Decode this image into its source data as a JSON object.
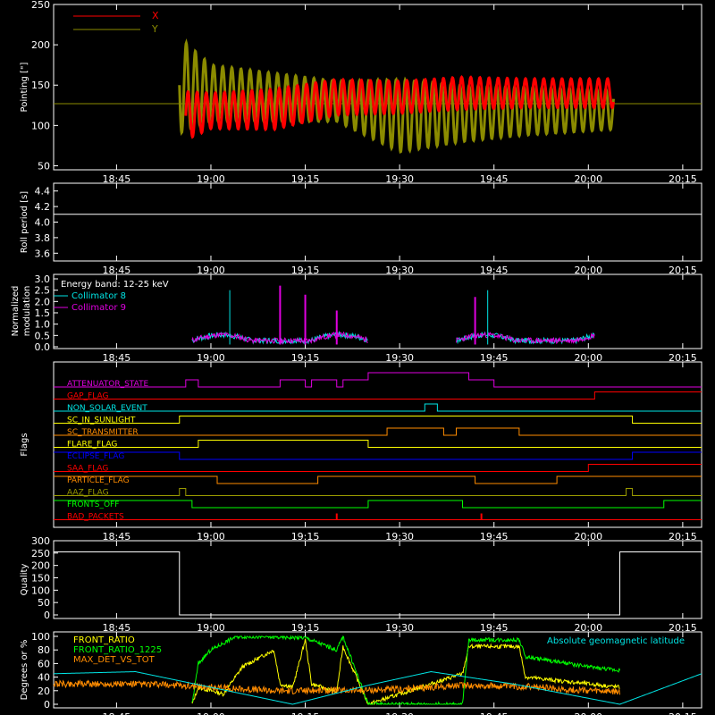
{
  "colors": {
    "background": "#000000",
    "axis": "#ffffff",
    "x_red": "#ff0000",
    "y_olive": "#8b8b00",
    "cyan": "#00e5e5",
    "magenta": "#e000e0",
    "yellow": "#ffff00",
    "green": "#00ff00",
    "orange": "#ff8c00",
    "blue": "#0000ff",
    "olive": "#9a9a00"
  },
  "time_ticks": [
    "18:45",
    "19:00",
    "19:15",
    "19:30",
    "19:45",
    "20:00",
    "20:15"
  ],
  "chart_data": [
    {
      "id": "pointing",
      "type": "line",
      "ylabel": "Pointing [\"]",
      "yticks": [
        "50",
        "100",
        "150",
        "200",
        "250"
      ],
      "ylim": [
        45,
        250
      ],
      "legend": [
        "X",
        "Y"
      ],
      "baseline": 127,
      "series": [
        {
          "name": "X",
          "color": "#ff0000",
          "x": [
            "18:56",
            "19:00",
            "19:10",
            "19:20",
            "19:30",
            "19:40",
            "19:50",
            "20:04"
          ],
          "center": [
            112,
            118,
            120,
            135,
            135,
            140,
            140,
            140
          ],
          "amplitude": [
            30,
            22,
            25,
            22,
            20,
            20,
            18,
            18
          ]
        },
        {
          "name": "Y",
          "color": "#8b8b00",
          "x": [
            "18:55",
            "19:00",
            "19:10",
            "19:20",
            "19:30",
            "19:40",
            "19:50",
            "20:04"
          ],
          "center": [
            150,
            140,
            135,
            130,
            112,
            115,
            118,
            120
          ],
          "amplitude": [
            60,
            35,
            30,
            25,
            45,
            35,
            30,
            25
          ]
        }
      ]
    },
    {
      "id": "roll-period",
      "type": "line",
      "ylabel": "Roll period [s]",
      "yticks": [
        "3.6",
        "3.8",
        "4.0",
        "4.2",
        "4.4"
      ],
      "ylim": [
        3.5,
        4.5
      ],
      "series": [
        {
          "name": "Roll period",
          "color": "#ffffff",
          "x": [
            "18:35",
            "20:18"
          ],
          "y": [
            4.1,
            4.1
          ]
        }
      ]
    },
    {
      "id": "modulation",
      "type": "line",
      "ylabel": "Normalized modulation",
      "yticks": [
        "0.0",
        "0.5",
        "1.0",
        "1.5",
        "2.0",
        "2.5",
        "3.0"
      ],
      "ylim": [
        0,
        3.0
      ],
      "legend": [
        "Energy band: 12-25 keV",
        "Collimator 8",
        "Collimator 9"
      ],
      "spikes_c8": [
        {
          "x": "19:03",
          "y": 2.5
        },
        {
          "x": "19:44",
          "y": 2.5
        }
      ],
      "spikes_c9": [
        {
          "x": "19:11",
          "y": 2.7
        },
        {
          "x": "19:15",
          "y": 2.3
        },
        {
          "x": "19:20",
          "y": 1.6
        },
        {
          "x": "19:42",
          "y": 2.2
        }
      ]
    },
    {
      "id": "flags",
      "type": "step",
      "ylabel": "Flags",
      "flags": [
        {
          "name": "ATTENUATOR_STATE",
          "color": "#e000e0",
          "x": [
            "18:35",
            "18:54",
            "18:56",
            "18:58",
            "19:11",
            "19:15",
            "19:16",
            "19:20",
            "19:21",
            "19:25",
            "19:41",
            "19:45",
            "20:18"
          ],
          "state": [
            0,
            0,
            1,
            0,
            1,
            0,
            1,
            0,
            1,
            2,
            1,
            0,
            0
          ]
        },
        {
          "name": "GAP_FLAG",
          "color": "#ff0000",
          "x": [
            "18:35",
            "20:01",
            "20:18"
          ],
          "state": [
            0,
            1,
            1
          ]
        },
        {
          "name": "NON_SOLAR_EVENT",
          "color": "#00e5e5",
          "x": [
            "18:35",
            "19:34",
            "19:36",
            "20:18"
          ],
          "state": [
            0,
            1,
            0,
            0
          ]
        },
        {
          "name": "SC_IN_SUNLIGHT",
          "color": "#ffff00",
          "x": [
            "18:35",
            "18:55",
            "20:07",
            "20:18"
          ],
          "state": [
            0,
            1,
            0,
            0
          ]
        },
        {
          "name": "SC_TRANSMITTER",
          "color": "#ff8c00",
          "x": [
            "18:35",
            "19:28",
            "19:37",
            "19:39",
            "19:49",
            "20:18"
          ],
          "state": [
            0,
            1,
            0,
            1,
            0,
            0
          ]
        },
        {
          "name": "FLARE_FLAG",
          "color": "#ffff00",
          "x": [
            "18:35",
            "18:58",
            "19:25",
            "20:18"
          ],
          "state": [
            0,
            1,
            0,
            0
          ]
        },
        {
          "name": "ECLIPSE_FLAG",
          "color": "#0000ff",
          "x": [
            "18:35",
            "18:55",
            "20:07",
            "20:18"
          ],
          "state": [
            1,
            0,
            1,
            1
          ]
        },
        {
          "name": "SAA_FLAG",
          "color": "#ff0000",
          "x": [
            "18:35",
            "20:00",
            "20:18"
          ],
          "state": [
            0,
            1,
            1
          ]
        },
        {
          "name": "PARTICLE_FLAG",
          "color": "#ff8c00",
          "x": [
            "18:35",
            "19:01",
            "19:17",
            "19:42",
            "19:55",
            "20:18"
          ],
          "state": [
            1,
            0,
            1,
            0,
            1,
            1
          ]
        },
        {
          "name": "AAZ_FLAG",
          "color": "#9a9a00",
          "x": [
            "18:35",
            "18:55",
            "18:56",
            "20:06",
            "20:07",
            "20:18"
          ],
          "state": [
            0,
            1,
            0,
            1,
            0,
            0
          ]
        },
        {
          "name": "FRONTS_OFF",
          "color": "#00ff00",
          "x": [
            "18:35",
            "18:57",
            "19:25",
            "19:40",
            "20:12",
            "20:18"
          ],
          "state": [
            1,
            0,
            1,
            0,
            1,
            1
          ]
        },
        {
          "name": "BAD_PACKETS",
          "color": "#ff0000",
          "x": [
            "18:35",
            "20:18"
          ],
          "state": [
            0,
            0
          ],
          "spikes": [
            "19:20",
            "19:43"
          ]
        }
      ]
    },
    {
      "id": "quality",
      "type": "step",
      "ylabel": "Quality",
      "yticks": [
        "0",
        "50",
        "100",
        "150",
        "200",
        "250",
        "300"
      ],
      "ylim": [
        0,
        300
      ],
      "series": [
        {
          "name": "Quality",
          "color": "#ffffff",
          "x": [
            "18:35",
            "18:55",
            "18:55",
            "20:05",
            "20:05",
            "20:18"
          ],
          "y": [
            255,
            255,
            0,
            0,
            255,
            255
          ]
        }
      ]
    },
    {
      "id": "ratios",
      "type": "line",
      "ylabel": "Degrees or %",
      "yticks": [
        "0",
        "20",
        "40",
        "60",
        "80",
        "100"
      ],
      "ylim": [
        0,
        100
      ],
      "legend": [
        "FRONT_RATIO",
        "FRONT_RATIO_1225",
        "MAX_DET_VS_TOT"
      ],
      "right_legend": "Absolute geomagnetic latitude",
      "series": [
        {
          "name": "FRONT_RATIO",
          "color": "#ffff00",
          "x": [
            "18:57",
            "18:58",
            "19:02",
            "19:05",
            "19:10",
            "19:11",
            "19:13",
            "19:15",
            "19:16",
            "19:20",
            "19:21",
            "19:25",
            "19:40",
            "19:41",
            "19:49",
            "19:50",
            "20:05"
          ],
          "y": [
            0,
            25,
            15,
            55,
            80,
            30,
            25,
            95,
            30,
            18,
            85,
            0,
            45,
            85,
            85,
            40,
            25
          ]
        },
        {
          "name": "FRONT_RATIO_1225",
          "color": "#00ff00",
          "x": [
            "18:57",
            "18:58",
            "19:00",
            "19:04",
            "19:15",
            "19:20",
            "19:21",
            "19:25",
            "19:40",
            "19:41",
            "19:49",
            "19:50",
            "20:00",
            "20:05"
          ],
          "y": [
            0,
            60,
            80,
            100,
            98,
            80,
            100,
            0,
            0,
            95,
            95,
            70,
            55,
            50
          ]
        },
        {
          "name": "MAX_DET_VS_TOT",
          "color": "#ff8c00",
          "x": [
            "18:35",
            "18:45",
            "18:55",
            "19:00",
            "19:10",
            "19:20",
            "19:30",
            "19:40",
            "19:50",
            "20:00",
            "20:05"
          ],
          "y": [
            30,
            30,
            28,
            25,
            20,
            20,
            22,
            28,
            26,
            20,
            18
          ]
        },
        {
          "name": "Absolute geomagnetic latitude",
          "color": "#00e5e5",
          "x": [
            "18:35",
            "18:48",
            "19:00",
            "19:13",
            "19:25",
            "19:35",
            "19:48",
            "20:05",
            "20:18"
          ],
          "y": [
            45,
            48,
            25,
            0,
            28,
            48,
            30,
            0,
            45
          ]
        }
      ]
    }
  ]
}
